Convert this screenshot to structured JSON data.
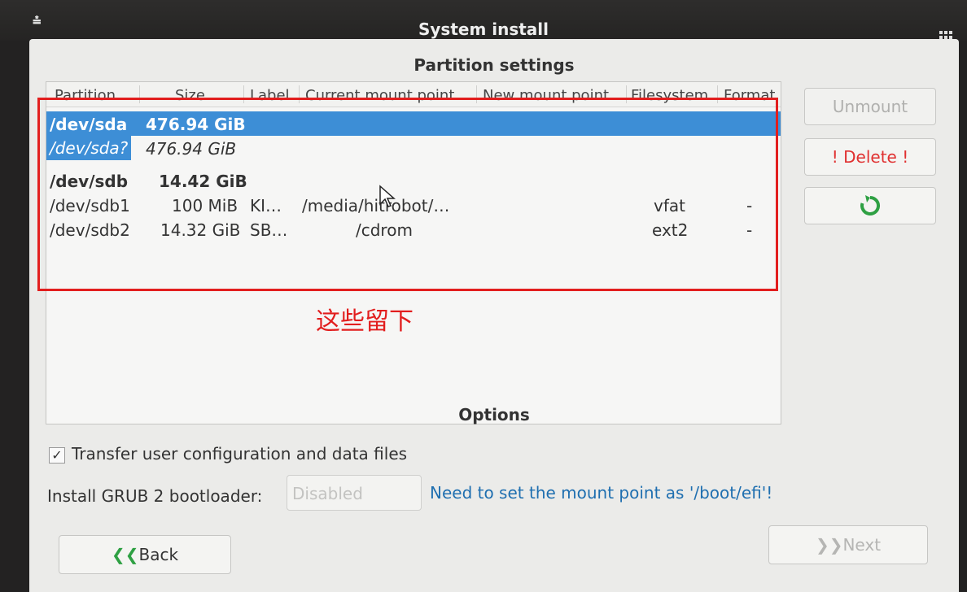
{
  "window": {
    "title": "System install"
  },
  "partition_settings": {
    "heading": "Partition settings",
    "columns": [
      "Partition",
      "Size",
      "Label",
      "Current mount point",
      "New mount point",
      "Filesystem",
      "Format"
    ],
    "rows": [
      {
        "partition": "/dev/sda",
        "size": "476.94 GiB",
        "label": "",
        "current_mount": "",
        "new_mount": "",
        "filesystem": "",
        "format": ""
      },
      {
        "partition": "/dev/sda?",
        "size": "476.94 GiB",
        "label": "",
        "current_mount": "",
        "new_mount": "",
        "filesystem": "",
        "format": ""
      },
      {
        "partition": "/dev/sdb",
        "size": "14.42 GiB",
        "label": "",
        "current_mount": "",
        "new_mount": "",
        "filesystem": "",
        "format": ""
      },
      {
        "partition": "/dev/sdb1",
        "size": "100 MiB",
        "label": "KI…",
        "current_mount": "/media/hitrobot/…",
        "new_mount": "",
        "filesystem": "vfat",
        "format": "-"
      },
      {
        "partition": "/dev/sdb2",
        "size": "14.32 GiB",
        "label": "SB…",
        "current_mount": "/cdrom",
        "new_mount": "",
        "filesystem": "ext2",
        "format": "-"
      }
    ],
    "buttons": {
      "unmount": "Unmount",
      "delete": "! Delete !"
    },
    "annotation": "这些留下"
  },
  "options": {
    "heading": "Options",
    "transfer_label": "Transfer user configuration and data files",
    "transfer_checked": true,
    "grub_label": "Install GRUB 2 bootloader:",
    "grub_value": "Disabled",
    "grub_hint": "Need to set the mount point as '/boot/efi'!"
  },
  "nav": {
    "back": "Back",
    "next": "Next"
  },
  "colors": {
    "selection": "#3d8ed6",
    "annotation": "#e21e1e",
    "refresh": "#2ea043",
    "delete": "#e03030"
  }
}
